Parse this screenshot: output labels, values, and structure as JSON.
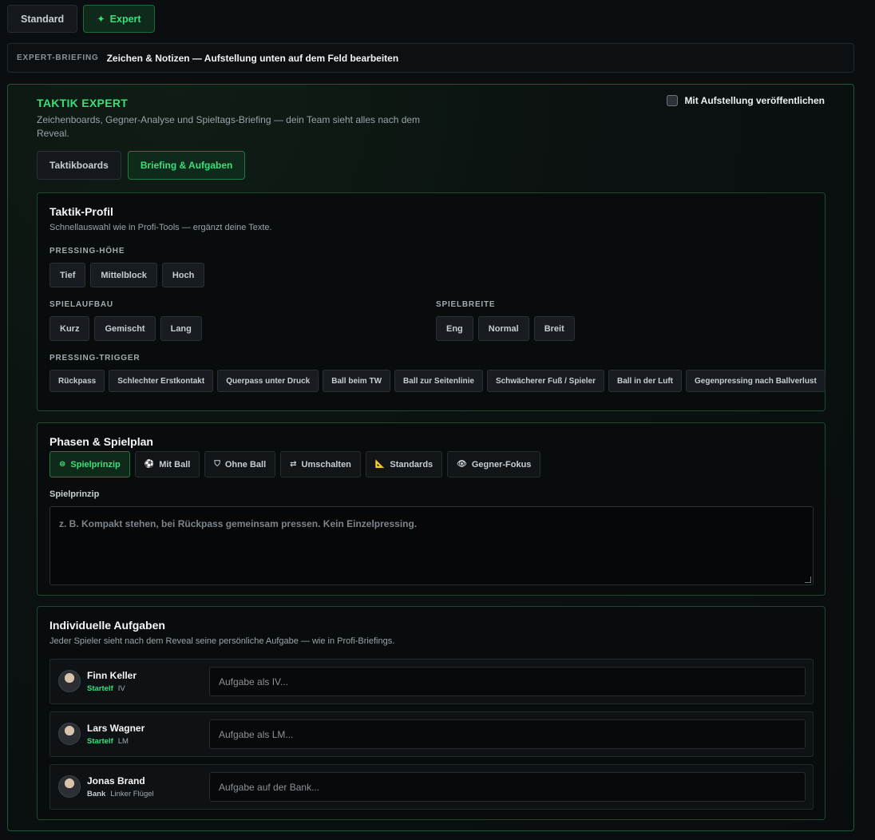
{
  "mode_tabs": {
    "standard": "Standard",
    "expert": "Expert",
    "expert_icon": "✦"
  },
  "briefing": {
    "tag": "EXPERT-BRIEFING",
    "text": "Zeichen & Notizen — Aufstellung unten auf dem Feld bearbeiten"
  },
  "panel": {
    "title": "TAKTIK EXPERT",
    "description": "Zeichenboards, Gegner-Analyse und Spieltags-Briefing — dein Team sieht alles nach dem Reveal.",
    "publish_label": "Mit Aufstellung veröffentlichen",
    "tabs": [
      "Taktikboards",
      "Briefing & Aufgaben"
    ]
  },
  "profile": {
    "title": "Taktik-Profil",
    "subtitle": "Schnellauswahl wie in Profi-Tools — ergänzt deine Texte.",
    "pressing_label": "PRESSING-HÖHE",
    "pressing_options": [
      "Tief",
      "Mittelblock",
      "Hoch"
    ],
    "buildup_label": "SPIELAUFBAU",
    "buildup_options": [
      "Kurz",
      "Gemischt",
      "Lang"
    ],
    "width_label": "SPIELBREITE",
    "width_options": [
      "Eng",
      "Normal",
      "Breit"
    ],
    "trigger_label": "PRESSING-TRIGGER",
    "trigger_options": [
      "Rückpass",
      "Schlechter Erstkontakt",
      "Querpass unter Druck",
      "Ball beim TW",
      "Ball zur Seitenlinie",
      "Schwächerer Fuß / Spieler",
      "Ball in der Luft",
      "Gegenpressing nach Ballverlust"
    ]
  },
  "phases": {
    "title": "Phasen & Spielplan",
    "tabs": [
      {
        "icon": "⊜",
        "label": "Spielprinzip"
      },
      {
        "icon": "⚽",
        "label": "Mit Ball"
      },
      {
        "icon": "⛉",
        "label": "Ohne Ball"
      },
      {
        "icon": "⇄",
        "label": "Umschalten"
      },
      {
        "icon": "📐",
        "label": "Standards"
      },
      {
        "icon": "👁",
        "label": "Gegner-Fokus"
      }
    ],
    "field_label": "Spielprinzip",
    "placeholder": "z. B. Kompakt stehen, bei Rückpass gemeinsam pressen. Kein Einzelpressing."
  },
  "tasks": {
    "title": "Individuelle Aufgaben",
    "subtitle": "Jeder Spieler sieht nach dem Reveal seine persönliche Aufgabe — wie in Profi-Briefings.",
    "players": [
      {
        "name": "Finn Keller",
        "status": "Startelf",
        "position": "IV",
        "placeholder": "Aufgabe als IV..."
      },
      {
        "name": "Lars Wagner",
        "status": "Startelf",
        "position": "LM",
        "placeholder": "Aufgabe als LM..."
      },
      {
        "name": "Jonas Brand",
        "status": "Bank",
        "position": "Linker Flügel",
        "placeholder": "Aufgabe auf der Bank..."
      }
    ]
  }
}
